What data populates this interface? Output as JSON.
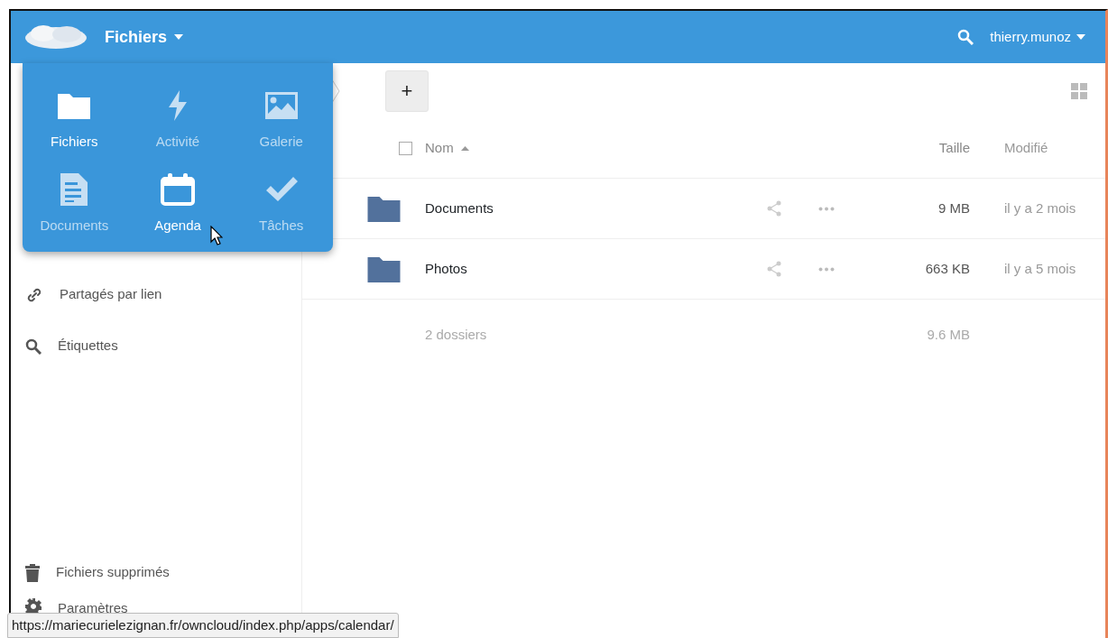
{
  "header": {
    "app_title": "Fichiers",
    "user": "thierry.munoz"
  },
  "app_menu": [
    {
      "label": "Fichiers",
      "kind": "folder",
      "active": true
    },
    {
      "label": "Activité",
      "kind": "bolt",
      "active": false
    },
    {
      "label": "Galerie",
      "kind": "image",
      "active": false
    },
    {
      "label": "Documents",
      "kind": "document",
      "active": false
    },
    {
      "label": "Agenda",
      "kind": "calendar",
      "active": true
    },
    {
      "label": "Tâches",
      "kind": "check",
      "active": false
    }
  ],
  "sidebar": {
    "items": [
      {
        "label": "Partagés par lien",
        "kind": "link"
      },
      {
        "label": "Étiquettes",
        "kind": "search"
      }
    ],
    "bottom_items": [
      {
        "label": "Fichiers supprimés",
        "kind": "trash"
      },
      {
        "label": "Paramètres",
        "kind": "gear"
      }
    ]
  },
  "toolbar": {
    "new_button": "+"
  },
  "table": {
    "select_all": {
      "checked": false
    },
    "columns": [
      "Nom",
      "Taille",
      "Modifié"
    ],
    "rows": [
      {
        "name": "Documents",
        "size": "9 MB",
        "modified": "il y a 2 mois"
      },
      {
        "name": "Photos",
        "size": "663 KB",
        "modified": "il y a 5 mois"
      }
    ],
    "summary": {
      "count": "2 dossiers",
      "size": "9.6 MB"
    }
  },
  "status_url": "https://mariecurielezignan.fr/owncloud/index.php/apps/calendar/"
}
